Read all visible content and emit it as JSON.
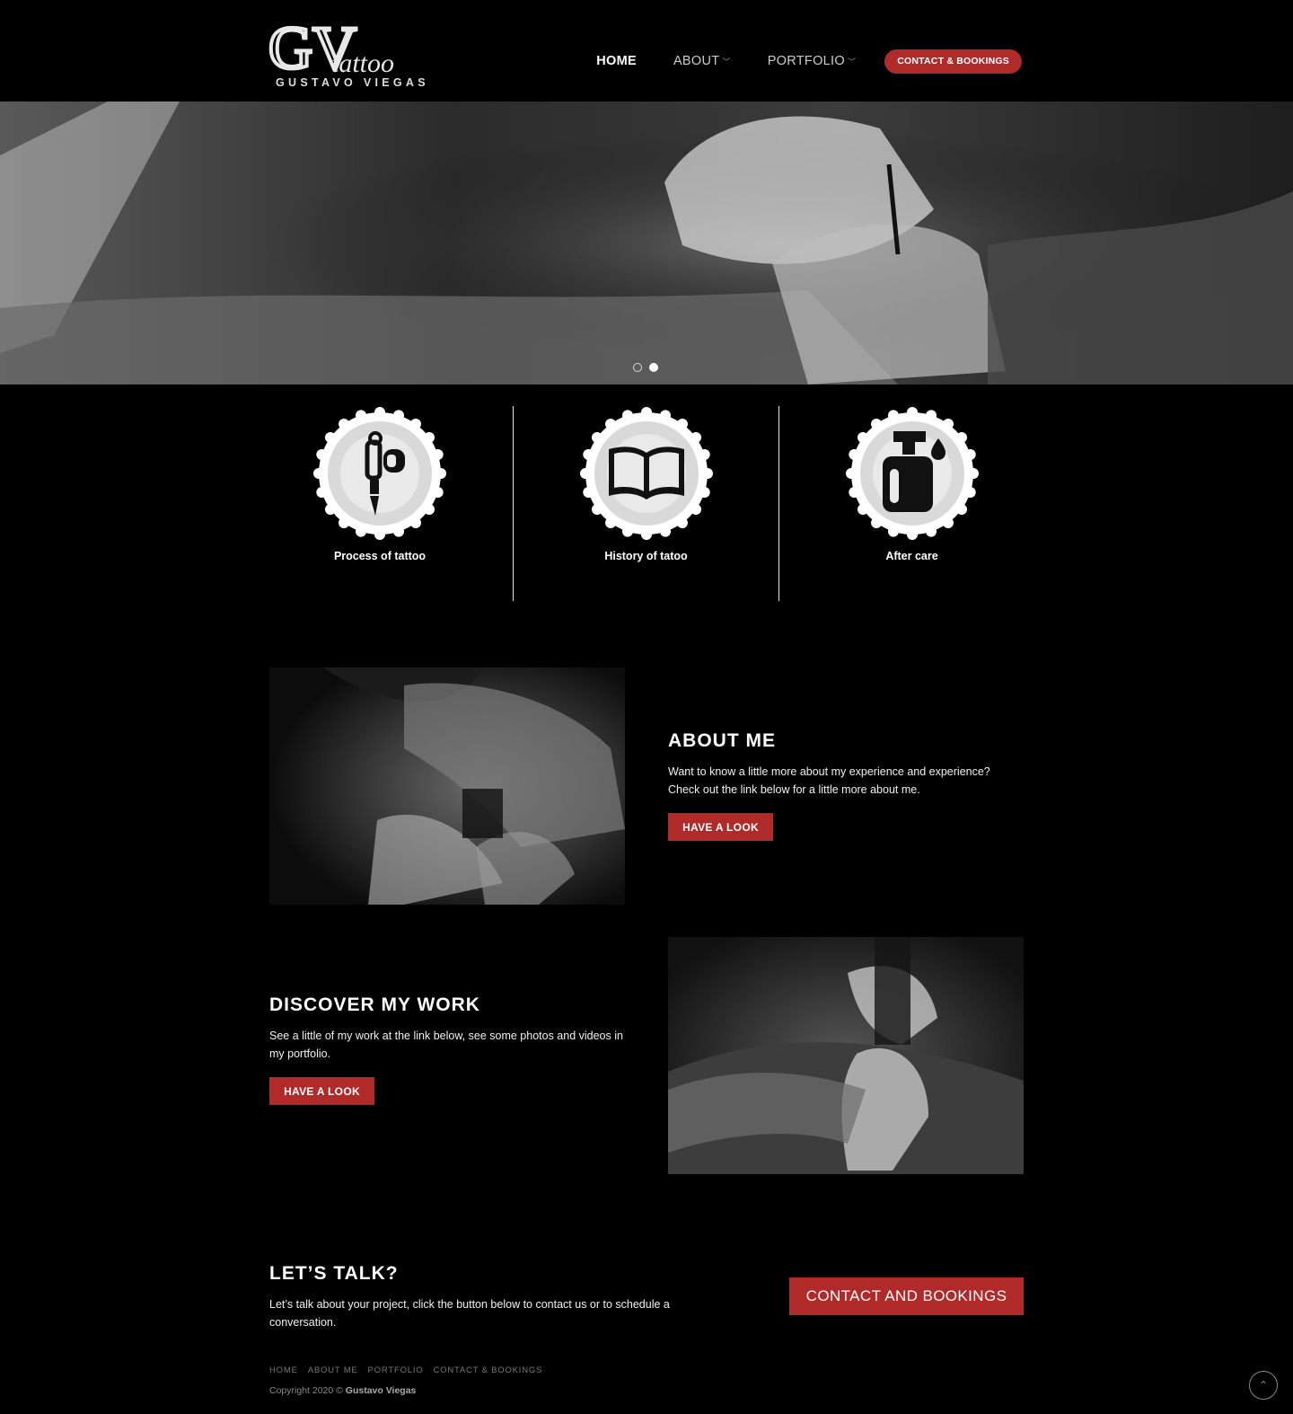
{
  "brand": {
    "logo_letters": "GV",
    "logo_script": "tattoo",
    "logo_subtitle": "GUSTAVO VIEGAS"
  },
  "nav": {
    "items": [
      {
        "label": "HOME",
        "has_dropdown": false
      },
      {
        "label": "ABOUT",
        "has_dropdown": true
      },
      {
        "label": "PORTFOLIO",
        "has_dropdown": true
      }
    ],
    "cta_label": "CONTACT & BOOKINGS",
    "chevron_glyph": "﹀"
  },
  "hero": {
    "slide_count": 2,
    "active_slide": 2
  },
  "features": [
    {
      "label": "Process of tattoo",
      "icon": "tattoo-machine-icon"
    },
    {
      "label": "History of tatoo",
      "icon": "open-book-icon"
    },
    {
      "label": "After care",
      "icon": "spray-bottle-icon"
    }
  ],
  "about": {
    "title": "ABOUT ME",
    "text": "Want to know a little more about my experience and experience? Check out the link below for a little more about me.",
    "button": "HAVE A LOOK"
  },
  "work": {
    "title": "DISCOVER MY WORK",
    "text": "See a little of my work at the link below, see some photos and videos in my portfolio.",
    "button": "HAVE A LOOK"
  },
  "talk": {
    "title": "LET’S TALK?",
    "text": "Let’s talk about your project, click the button below to contact us or to schedule a conversation.",
    "button": "CONTACT AND BOOKINGS"
  },
  "footer": {
    "links": [
      "HOME",
      "ABOUT ME",
      "PORTFOLIO",
      "CONTACT & BOOKINGS"
    ],
    "copyright_prefix": "Copyright 2020 ©",
    "copyright_name": "Gustavo Viegas",
    "to_top_glyph": "⌃"
  },
  "colors": {
    "accent": "#b12a2a",
    "background": "#000000",
    "text": "#ffffff"
  }
}
